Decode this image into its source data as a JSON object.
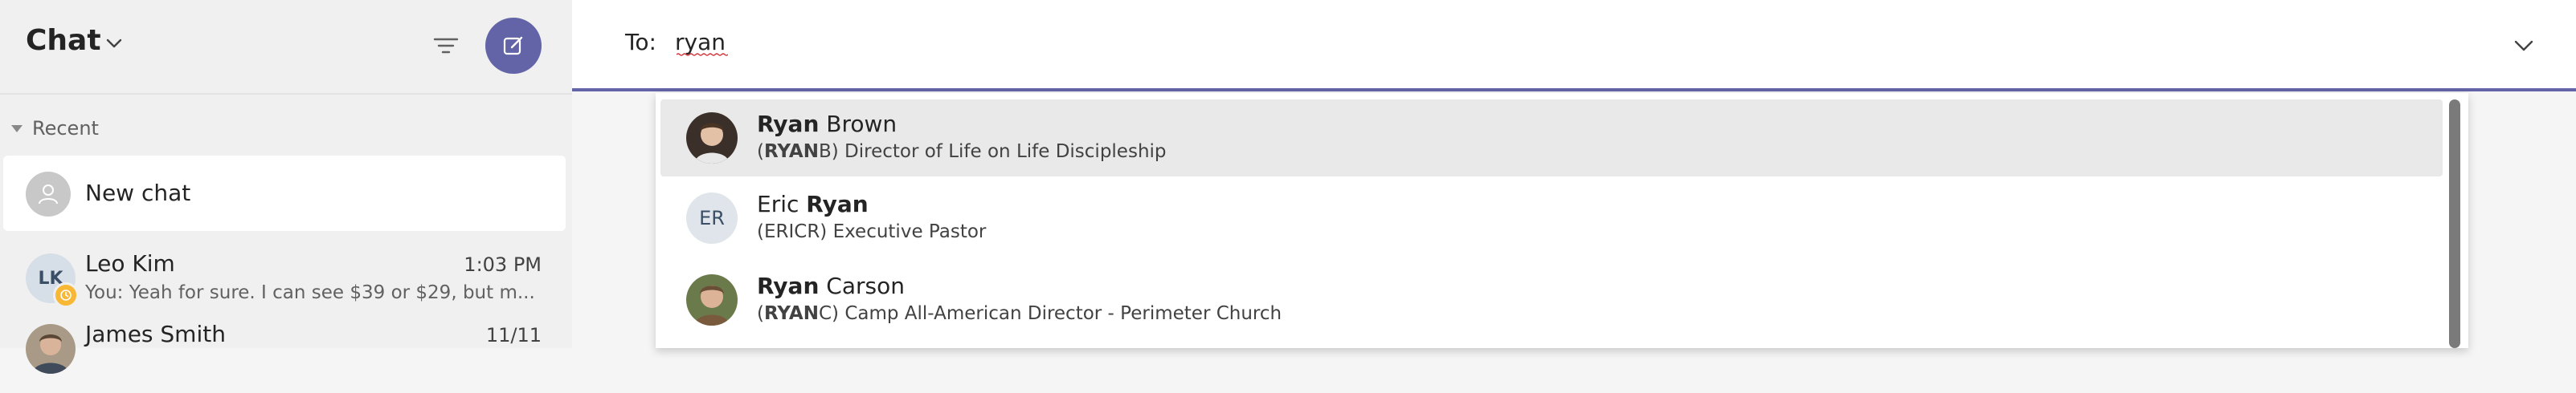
{
  "sidebar": {
    "title": "Chat",
    "recent_label": "Recent",
    "new_chat_label": "New chat",
    "chats": [
      {
        "initials": "LK",
        "name": "Leo Kim",
        "time": "1:03 PM",
        "preview": "You: Yeah for sure. I can see $39 or $29, but m..."
      },
      {
        "initials": "",
        "name": "James Smith",
        "time": "11/11",
        "preview": ""
      }
    ]
  },
  "compose": {
    "to_label": "To:",
    "to_value": "ryan"
  },
  "results": [
    {
      "first": "Ryan",
      "last": "Brown",
      "handle_bold": "RYAN",
      "handle_rest": "B",
      "title": "Director of Life on Life Discipleship",
      "highlighted": true
    },
    {
      "first": "Eric",
      "last": "Ryan",
      "initials": "ER",
      "handle": "(ERICR)",
      "title": "Executive Pastor",
      "highlighted": false
    },
    {
      "first": "Ryan",
      "last": "Carson",
      "handle_bold": "RYAN",
      "handle_rest": "C",
      "title": "Camp All-American Director - Perimeter Church",
      "highlighted": false
    }
  ],
  "colors": {
    "accent": "#6264a7",
    "presence_away": "#f8b734",
    "highlight_row": "#e9e9e9"
  },
  "icons": [
    "chevron-down-icon",
    "filter-icon",
    "compose-icon",
    "person-icon",
    "clock-icon"
  ]
}
